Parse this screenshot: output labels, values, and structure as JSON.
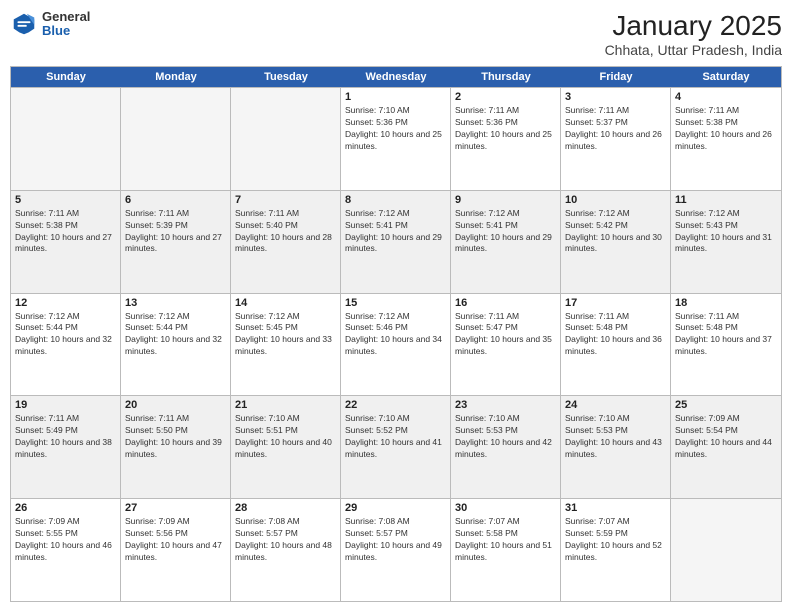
{
  "header": {
    "logo": {
      "general": "General",
      "blue": "Blue"
    },
    "title": "January 2025",
    "subtitle": "Chhata, Uttar Pradesh, India"
  },
  "days_of_week": [
    "Sunday",
    "Monday",
    "Tuesday",
    "Wednesday",
    "Thursday",
    "Friday",
    "Saturday"
  ],
  "weeks": [
    [
      {
        "num": "",
        "empty": true
      },
      {
        "num": "",
        "empty": true
      },
      {
        "num": "",
        "empty": true
      },
      {
        "num": "1",
        "sunrise": "Sunrise: 7:10 AM",
        "sunset": "Sunset: 5:36 PM",
        "daylight": "Daylight: 10 hours and 25 minutes."
      },
      {
        "num": "2",
        "sunrise": "Sunrise: 7:11 AM",
        "sunset": "Sunset: 5:36 PM",
        "daylight": "Daylight: 10 hours and 25 minutes."
      },
      {
        "num": "3",
        "sunrise": "Sunrise: 7:11 AM",
        "sunset": "Sunset: 5:37 PM",
        "daylight": "Daylight: 10 hours and 26 minutes."
      },
      {
        "num": "4",
        "sunrise": "Sunrise: 7:11 AM",
        "sunset": "Sunset: 5:38 PM",
        "daylight": "Daylight: 10 hours and 26 minutes."
      }
    ],
    [
      {
        "num": "5",
        "sunrise": "Sunrise: 7:11 AM",
        "sunset": "Sunset: 5:38 PM",
        "daylight": "Daylight: 10 hours and 27 minutes."
      },
      {
        "num": "6",
        "sunrise": "Sunrise: 7:11 AM",
        "sunset": "Sunset: 5:39 PM",
        "daylight": "Daylight: 10 hours and 27 minutes."
      },
      {
        "num": "7",
        "sunrise": "Sunrise: 7:11 AM",
        "sunset": "Sunset: 5:40 PM",
        "daylight": "Daylight: 10 hours and 28 minutes."
      },
      {
        "num": "8",
        "sunrise": "Sunrise: 7:12 AM",
        "sunset": "Sunset: 5:41 PM",
        "daylight": "Daylight: 10 hours and 29 minutes."
      },
      {
        "num": "9",
        "sunrise": "Sunrise: 7:12 AM",
        "sunset": "Sunset: 5:41 PM",
        "daylight": "Daylight: 10 hours and 29 minutes."
      },
      {
        "num": "10",
        "sunrise": "Sunrise: 7:12 AM",
        "sunset": "Sunset: 5:42 PM",
        "daylight": "Daylight: 10 hours and 30 minutes."
      },
      {
        "num": "11",
        "sunrise": "Sunrise: 7:12 AM",
        "sunset": "Sunset: 5:43 PM",
        "daylight": "Daylight: 10 hours and 31 minutes."
      }
    ],
    [
      {
        "num": "12",
        "sunrise": "Sunrise: 7:12 AM",
        "sunset": "Sunset: 5:44 PM",
        "daylight": "Daylight: 10 hours and 32 minutes."
      },
      {
        "num": "13",
        "sunrise": "Sunrise: 7:12 AM",
        "sunset": "Sunset: 5:44 PM",
        "daylight": "Daylight: 10 hours and 32 minutes."
      },
      {
        "num": "14",
        "sunrise": "Sunrise: 7:12 AM",
        "sunset": "Sunset: 5:45 PM",
        "daylight": "Daylight: 10 hours and 33 minutes."
      },
      {
        "num": "15",
        "sunrise": "Sunrise: 7:12 AM",
        "sunset": "Sunset: 5:46 PM",
        "daylight": "Daylight: 10 hours and 34 minutes."
      },
      {
        "num": "16",
        "sunrise": "Sunrise: 7:11 AM",
        "sunset": "Sunset: 5:47 PM",
        "daylight": "Daylight: 10 hours and 35 minutes."
      },
      {
        "num": "17",
        "sunrise": "Sunrise: 7:11 AM",
        "sunset": "Sunset: 5:48 PM",
        "daylight": "Daylight: 10 hours and 36 minutes."
      },
      {
        "num": "18",
        "sunrise": "Sunrise: 7:11 AM",
        "sunset": "Sunset: 5:48 PM",
        "daylight": "Daylight: 10 hours and 37 minutes."
      }
    ],
    [
      {
        "num": "19",
        "sunrise": "Sunrise: 7:11 AM",
        "sunset": "Sunset: 5:49 PM",
        "daylight": "Daylight: 10 hours and 38 minutes."
      },
      {
        "num": "20",
        "sunrise": "Sunrise: 7:11 AM",
        "sunset": "Sunset: 5:50 PM",
        "daylight": "Daylight: 10 hours and 39 minutes."
      },
      {
        "num": "21",
        "sunrise": "Sunrise: 7:10 AM",
        "sunset": "Sunset: 5:51 PM",
        "daylight": "Daylight: 10 hours and 40 minutes."
      },
      {
        "num": "22",
        "sunrise": "Sunrise: 7:10 AM",
        "sunset": "Sunset: 5:52 PM",
        "daylight": "Daylight: 10 hours and 41 minutes."
      },
      {
        "num": "23",
        "sunrise": "Sunrise: 7:10 AM",
        "sunset": "Sunset: 5:53 PM",
        "daylight": "Daylight: 10 hours and 42 minutes."
      },
      {
        "num": "24",
        "sunrise": "Sunrise: 7:10 AM",
        "sunset": "Sunset: 5:53 PM",
        "daylight": "Daylight: 10 hours and 43 minutes."
      },
      {
        "num": "25",
        "sunrise": "Sunrise: 7:09 AM",
        "sunset": "Sunset: 5:54 PM",
        "daylight": "Daylight: 10 hours and 44 minutes."
      }
    ],
    [
      {
        "num": "26",
        "sunrise": "Sunrise: 7:09 AM",
        "sunset": "Sunset: 5:55 PM",
        "daylight": "Daylight: 10 hours and 46 minutes."
      },
      {
        "num": "27",
        "sunrise": "Sunrise: 7:09 AM",
        "sunset": "Sunset: 5:56 PM",
        "daylight": "Daylight: 10 hours and 47 minutes."
      },
      {
        "num": "28",
        "sunrise": "Sunrise: 7:08 AM",
        "sunset": "Sunset: 5:57 PM",
        "daylight": "Daylight: 10 hours and 48 minutes."
      },
      {
        "num": "29",
        "sunrise": "Sunrise: 7:08 AM",
        "sunset": "Sunset: 5:57 PM",
        "daylight": "Daylight: 10 hours and 49 minutes."
      },
      {
        "num": "30",
        "sunrise": "Sunrise: 7:07 AM",
        "sunset": "Sunset: 5:58 PM",
        "daylight": "Daylight: 10 hours and 51 minutes."
      },
      {
        "num": "31",
        "sunrise": "Sunrise: 7:07 AM",
        "sunset": "Sunset: 5:59 PM",
        "daylight": "Daylight: 10 hours and 52 minutes."
      },
      {
        "num": "",
        "empty": true
      }
    ]
  ]
}
